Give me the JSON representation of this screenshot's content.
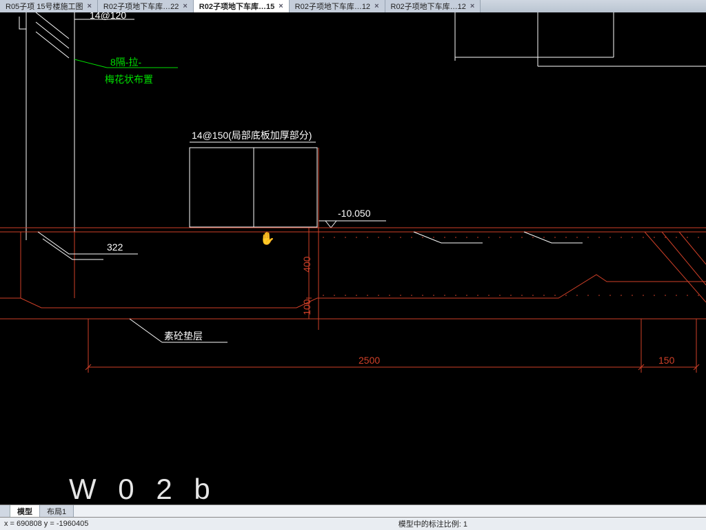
{
  "tabs": {
    "items": [
      {
        "label": "R05子项 15号楼施工图",
        "active": false
      },
      {
        "label": "R02子项地下车库…22",
        "active": false
      },
      {
        "label": "R02子项地下车库…15",
        "active": true
      },
      {
        "label": "R02子项地下车库…12",
        "active": false
      },
      {
        "label": "R02子项地下车库…12",
        "active": false
      }
    ],
    "close_glyph": "×"
  },
  "bottom_tabs": {
    "items": [
      {
        "label": "模型",
        "active": true
      },
      {
        "label": "布局1",
        "active": false
      }
    ]
  },
  "status": {
    "coords": "x = 690808  y = -1960405",
    "scale": "模型中的标注比例: 1"
  },
  "cad": {
    "notes": {
      "top_dim": "14@120",
      "green1": "8隔-拉-",
      "green2": "梅花状布置",
      "thick_note": "14@150(局部底板加厚部分)",
      "elev": "-10.050",
      "label322": "322",
      "bedding": "素砼垫层",
      "dim400": "400",
      "dim100": "100",
      "dim2500": "2500",
      "dim150": "150",
      "bottom_text": "W 0 2 b"
    }
  }
}
